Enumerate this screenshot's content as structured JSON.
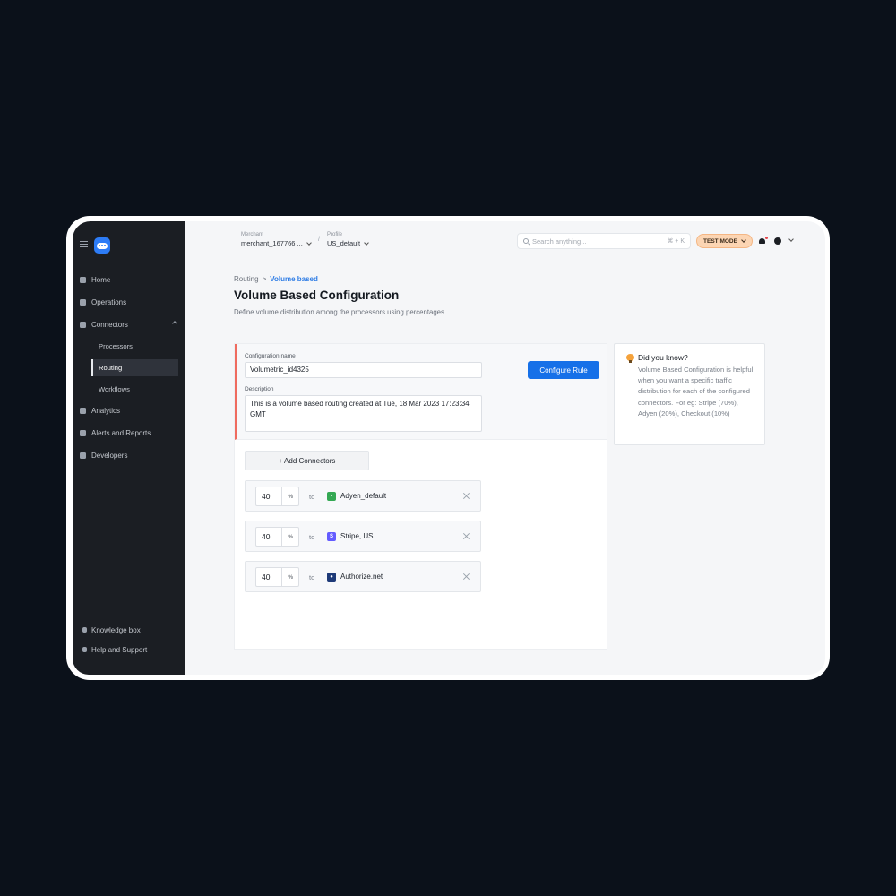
{
  "topbar": {
    "merchant_label": "Merchant",
    "merchant_value": "merchant_167766 ...",
    "separator": "/",
    "profile_label": "Profile",
    "profile_value": "US_default",
    "search_placeholder": "Search anything...",
    "search_shortcut": "⌘ + K",
    "mode_label": "TEST MODE"
  },
  "sidebar": {
    "items": [
      {
        "label": "Home",
        "icon": "home-icon"
      },
      {
        "label": "Operations",
        "icon": "operations-icon"
      },
      {
        "label": "Connectors",
        "icon": "connectors-icon",
        "expanded": true
      },
      {
        "label": "Analytics",
        "icon": "analytics-icon"
      },
      {
        "label": "Alerts and Reports",
        "icon": "alerts-icon"
      },
      {
        "label": "Developers",
        "icon": "developers-icon"
      }
    ],
    "subitems": [
      {
        "label": "Processors"
      },
      {
        "label": "Routing",
        "active": true
      },
      {
        "label": "Workflows"
      }
    ],
    "bottom": [
      {
        "label": "Knowledge box",
        "icon": "lightbulb-icon"
      },
      {
        "label": "Help and Support",
        "icon": "support-icon"
      }
    ]
  },
  "breadcrumb": {
    "parent": "Routing",
    "separator": ">",
    "current": "Volume based"
  },
  "page": {
    "title": "Volume Based Configuration",
    "subtitle": "Define volume distribution among the processors using percentages."
  },
  "config": {
    "name_label": "Configuration name",
    "name_value": "Volumetric_id4325",
    "description_label": "Description",
    "description_value": "This is a volume based routing created at Tue, 18 Mar 2023 17:23:34 GMT",
    "configure_button": "Configure Rule",
    "add_connectors_button": "+ Add Connectors"
  },
  "connectors": [
    {
      "percent": "40",
      "unit": "%",
      "to": "to",
      "name": "Adyen_default",
      "color": "#34a853",
      "glyph": "▪"
    },
    {
      "percent": "40",
      "unit": "%",
      "to": "to",
      "name": "Stripe, US",
      "color": "#635bff",
      "glyph": "S"
    },
    {
      "percent": "40",
      "unit": "%",
      "to": "to",
      "name": "Authorize.net",
      "color": "#1e3a78",
      "glyph": "●"
    }
  ],
  "tip": {
    "title": "Did you know?",
    "body": "Volume Based Configuration is helpful when you want a specific traffic distribution for each of the configured connectors. For eg: Stripe (70%), Adyen (20%), Checkout (10%)"
  },
  "colors": {
    "accent": "#1670e8",
    "sidebar_bg": "#1b1e23",
    "test_mode_bg": "#fcd5b3",
    "card_accent": "#ef6b5f"
  }
}
